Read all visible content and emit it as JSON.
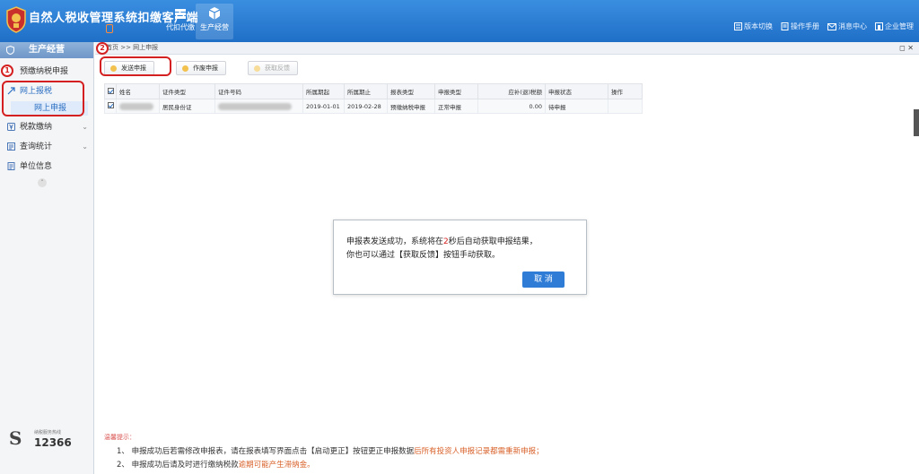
{
  "header": {
    "app_title": "自然人税收管理系统扣缴客户端",
    "app_tag": "",
    "modules": [
      {
        "label": "代扣代缴",
        "icon": "stack-icon",
        "active": false
      },
      {
        "label": "生产经营",
        "icon": "cube-icon",
        "active": true
      }
    ],
    "links": [
      {
        "label": "版本切换",
        "icon": "switch-icon"
      },
      {
        "label": "操作手册",
        "icon": "manual-icon"
      },
      {
        "label": "消息中心",
        "icon": "mail-icon"
      },
      {
        "label": "企业管理",
        "icon": "enterprise-icon"
      }
    ]
  },
  "sidebar": {
    "title": "生产经营",
    "items": [
      {
        "label": "预缴纳税申报",
        "icon": "",
        "chevron": ""
      },
      {
        "label": "网上报税",
        "icon": "arrow-icon",
        "chevron": "",
        "sub": "网上申报"
      },
      {
        "label": "税款缴纳",
        "icon": "yen-icon",
        "chevron": "⌄"
      },
      {
        "label": "查询统计",
        "icon": "list-icon",
        "chevron": "⌄"
      },
      {
        "label": "单位信息",
        "icon": "doc-icon",
        "chevron": ""
      }
    ],
    "hotline": {
      "small": "纳税服务热线",
      "number": "12366"
    }
  },
  "breadcrumb": "首页 >> 网上申报",
  "toolbar": {
    "send": "发送申报",
    "cancel_report": "作废申报",
    "feedback": "获取反馈"
  },
  "table": {
    "headers": [
      "姓名",
      "证件类型",
      "证件号码",
      "所属期起",
      "所属期止",
      "报表类型",
      "申报类型",
      "应补(退)税额",
      "申报状态",
      "操作"
    ],
    "rows": [
      {
        "name": "",
        "id_type": "居民身份证",
        "id_no": "",
        "period_start": "2019-01-01",
        "period_end": "2019-02-28",
        "report_type": "预缴纳税申报",
        "declare_type": "正常申报",
        "tax": "0.00",
        "status": "待申报",
        "op": ""
      }
    ]
  },
  "dialog": {
    "line1_a": "申报表发送成功，系统将在",
    "countdown": "2",
    "line1_b": "秒后自动获取申报结果，",
    "line2": "你也可以通过【获取反馈】按钮手动获取。",
    "cancel_label": "取 消"
  },
  "notes": {
    "title": "温馨提示：",
    "line1_a": "1、 申报成功后若需修改申报表，请在报表填写界面点击【启动更正】按钮更正申报数据",
    "line1_b": "后所有投资人申报记录都需重新申报；",
    "line2_a": "2、 申报成功后请及时进行缴纳税款",
    "line2_b": "逾期可能产生滞纳金。"
  },
  "annotations": [
    "1",
    "2"
  ],
  "colors": {
    "header": "#2a7fd6",
    "accent": "#2f7cd6",
    "annotation": "#d42020",
    "warning": "#d9622b"
  }
}
